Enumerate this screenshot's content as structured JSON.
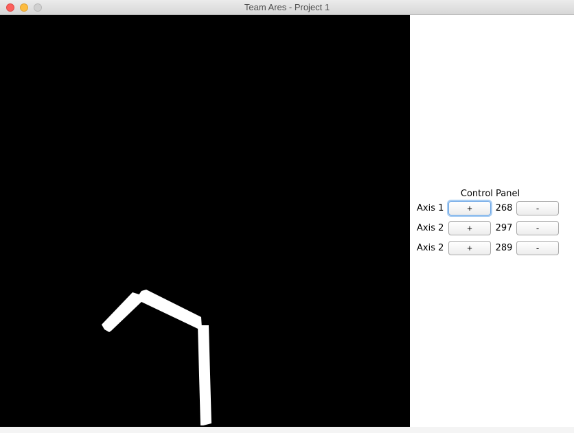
{
  "window": {
    "title": "Team Ares - Project 1"
  },
  "control_panel": {
    "title": "Control Panel",
    "axes": [
      {
        "label": "Axis 1",
        "plus": "+",
        "value": "268",
        "minus": "-"
      },
      {
        "label": "Axis 2",
        "plus": "+",
        "value": "297",
        "minus": "-"
      },
      {
        "label": "Axis 2",
        "plus": "+",
        "value": "289",
        "minus": "-"
      }
    ]
  },
  "canvas": {
    "background": "#000000",
    "arm_color": "#ffffff"
  }
}
